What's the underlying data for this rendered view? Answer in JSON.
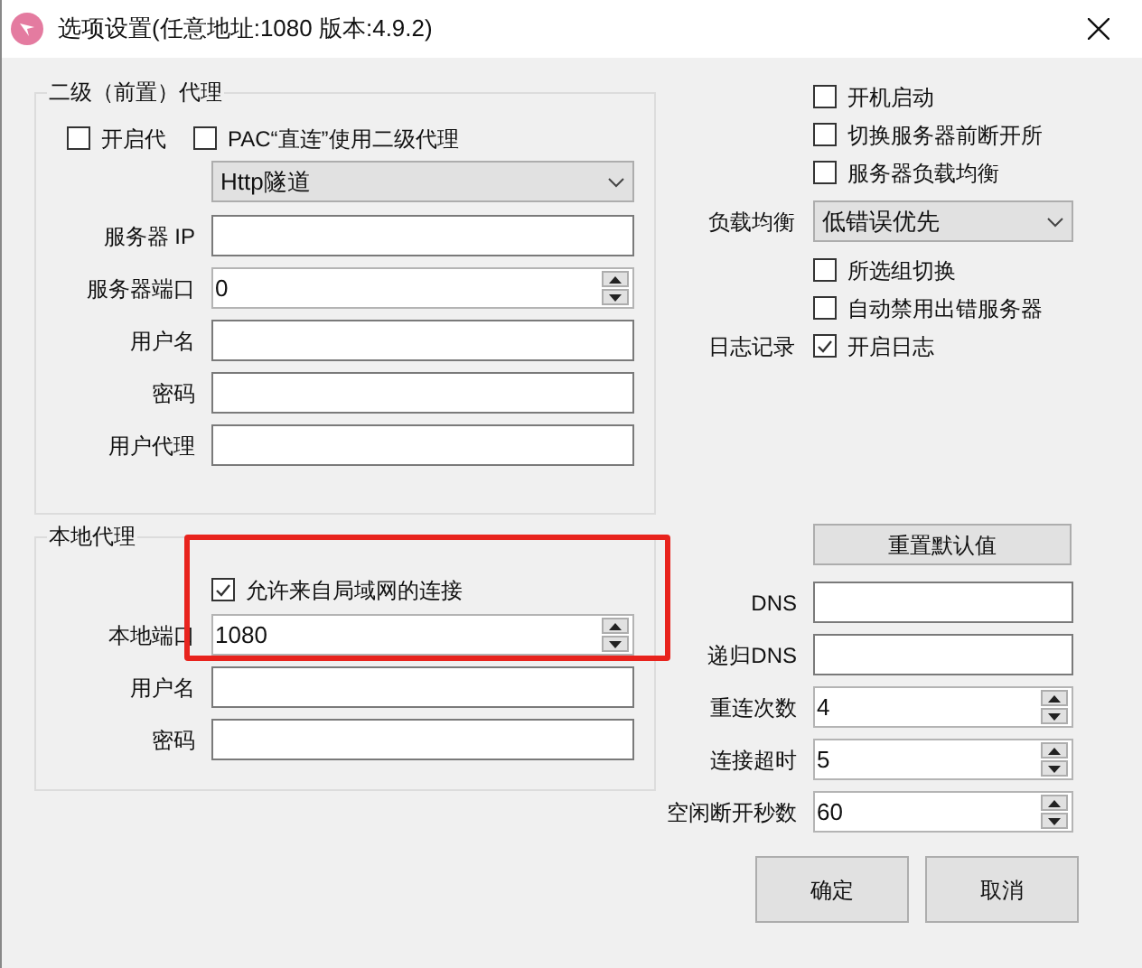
{
  "window": {
    "title": "选项设置(任意地址:1080 版本:4.9.2)"
  },
  "proxy_group": {
    "title": "二级（前置）代理",
    "enable": {
      "label": "开启代",
      "checked": false
    },
    "pac": {
      "label": "PAC“直连”使用二级代理",
      "checked": false
    },
    "mode_select": {
      "value": "Http隧道"
    },
    "fields": [
      {
        "kind": "text",
        "label": "服务器 IP"
      },
      {
        "kind": "spinner",
        "label": "服务器端口",
        "value": "0"
      },
      {
        "kind": "text",
        "label": "用户名"
      },
      {
        "kind": "text",
        "label": "密码"
      },
      {
        "kind": "text",
        "label": "用户代理"
      }
    ]
  },
  "local_group": {
    "title": "本地代理",
    "allow_lan": {
      "label": "允许来自局域网的连接",
      "checked": true
    },
    "fields": [
      {
        "kind": "spinner",
        "label": "本地端口",
        "value": "1080"
      },
      {
        "kind": "text",
        "label": "用户名"
      },
      {
        "kind": "text",
        "label": "密码"
      }
    ]
  },
  "general": [
    {
      "kind": "checkbox",
      "label": "开机启动",
      "checked": false
    },
    {
      "kind": "checkbox",
      "label": "切换服务器前断开所",
      "checked": false
    },
    {
      "kind": "checkbox",
      "label": "服务器负载均衡",
      "checked": false
    },
    {
      "kind": "select",
      "caption": "负载均衡",
      "value": "低错误优先"
    },
    {
      "kind": "checkbox",
      "label": "所选组切换",
      "checked": false
    },
    {
      "kind": "checkbox",
      "label": "自动禁用出错服务器",
      "checked": false
    },
    {
      "kind": "checkbox",
      "caption": "日志记录",
      "label": "开启日志",
      "checked": true
    }
  ],
  "reset_button": "重置默认值",
  "network_fields": [
    {
      "kind": "text",
      "label": "DNS"
    },
    {
      "kind": "text",
      "label": "递归DNS"
    },
    {
      "kind": "spinner",
      "label": "重连次数",
      "value": "4"
    },
    {
      "kind": "spinner",
      "label": "连接超时",
      "value": "5"
    },
    {
      "kind": "spinner",
      "label": "空闲断开秒数",
      "value": "60"
    }
  ],
  "buttons": [
    "确定",
    "取消"
  ]
}
